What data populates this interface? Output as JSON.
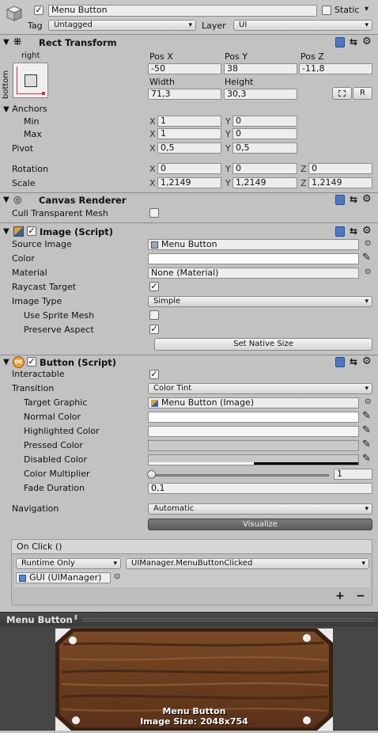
{
  "header": {
    "object_name": "Menu Button",
    "static_label": "Static",
    "tag_label": "Tag",
    "tag_value": "Untagged",
    "layer_label": "Layer",
    "layer_value": "UI"
  },
  "rect_transform": {
    "title": "Rect Transform",
    "anchor_h": "right",
    "anchor_v": "bottom",
    "pos_x_label": "Pos X",
    "pos_y_label": "Pos Y",
    "pos_z_label": "Pos Z",
    "pos_x": "-50",
    "pos_y": "38",
    "pos_z": "-11,8",
    "width_label": "Width",
    "height_label": "Height",
    "width": "71,3",
    "height": "30,3",
    "r_label": "R",
    "anchors_label": "Anchors",
    "min_label": "Min",
    "max_label": "Max",
    "min_x": "1",
    "min_y": "0",
    "max_x": "1",
    "max_y": "0",
    "pivot_label": "Pivot",
    "pivot_x": "0,5",
    "pivot_y": "0,5",
    "rotation_label": "Rotation",
    "rot_x": "0",
    "rot_y": "0",
    "rot_z": "0",
    "scale_label": "Scale",
    "scale_x": "1,2149",
    "scale_y": "1,2149",
    "scale_z": "1,2149",
    "x": "X",
    "y": "Y",
    "z": "Z"
  },
  "canvas_renderer": {
    "title": "Canvas Renderer",
    "cull_label": "Cull Transparent Mesh",
    "cull_checked": false
  },
  "image": {
    "title": "Image (Script)",
    "source_label": "Source Image",
    "source_value": "Menu Button",
    "color_label": "Color",
    "material_label": "Material",
    "material_value": "None (Material)",
    "raycast_label": "Raycast Target",
    "raycast_mark": "✓",
    "type_label": "Image Type",
    "type_value": "Simple",
    "sprite_mesh_label": "Use Sprite Mesh",
    "preserve_label": "Preserve Aspect",
    "preserve_mark": "✓",
    "native_button": "Set Native Size"
  },
  "button": {
    "title": "Button (Script)",
    "ok_badge": "OK",
    "interactable_label": "Interactable",
    "interactable_mark": "✓",
    "transition_label": "Transition",
    "transition_value": "Color Tint",
    "target_label": "Target Graphic",
    "target_value": "Menu Button (Image)",
    "normal_label": "Normal Color",
    "highlighted_label": "Highlighted Color",
    "pressed_label": "Pressed Color",
    "disabled_label": "Disabled Color",
    "multiplier_label": "Color Multiplier",
    "multiplier_value": "1",
    "multiplier_fraction": 0.0,
    "fade_label": "Fade Duration",
    "fade_value": "0,1",
    "navigation_label": "Navigation",
    "navigation_value": "Automatic",
    "visualize_label": "Visualize"
  },
  "on_click": {
    "title": "On Click ()",
    "runtime_value": "Runtime Only",
    "function_value": "UIManager.MenuButtonClicked",
    "object_value": "GUI (UIManager)",
    "plus": "+",
    "minus": "−"
  },
  "preview": {
    "title": "Menu Button",
    "caption_name": "Menu Button",
    "caption_size": "Image Size: 2048x754"
  }
}
